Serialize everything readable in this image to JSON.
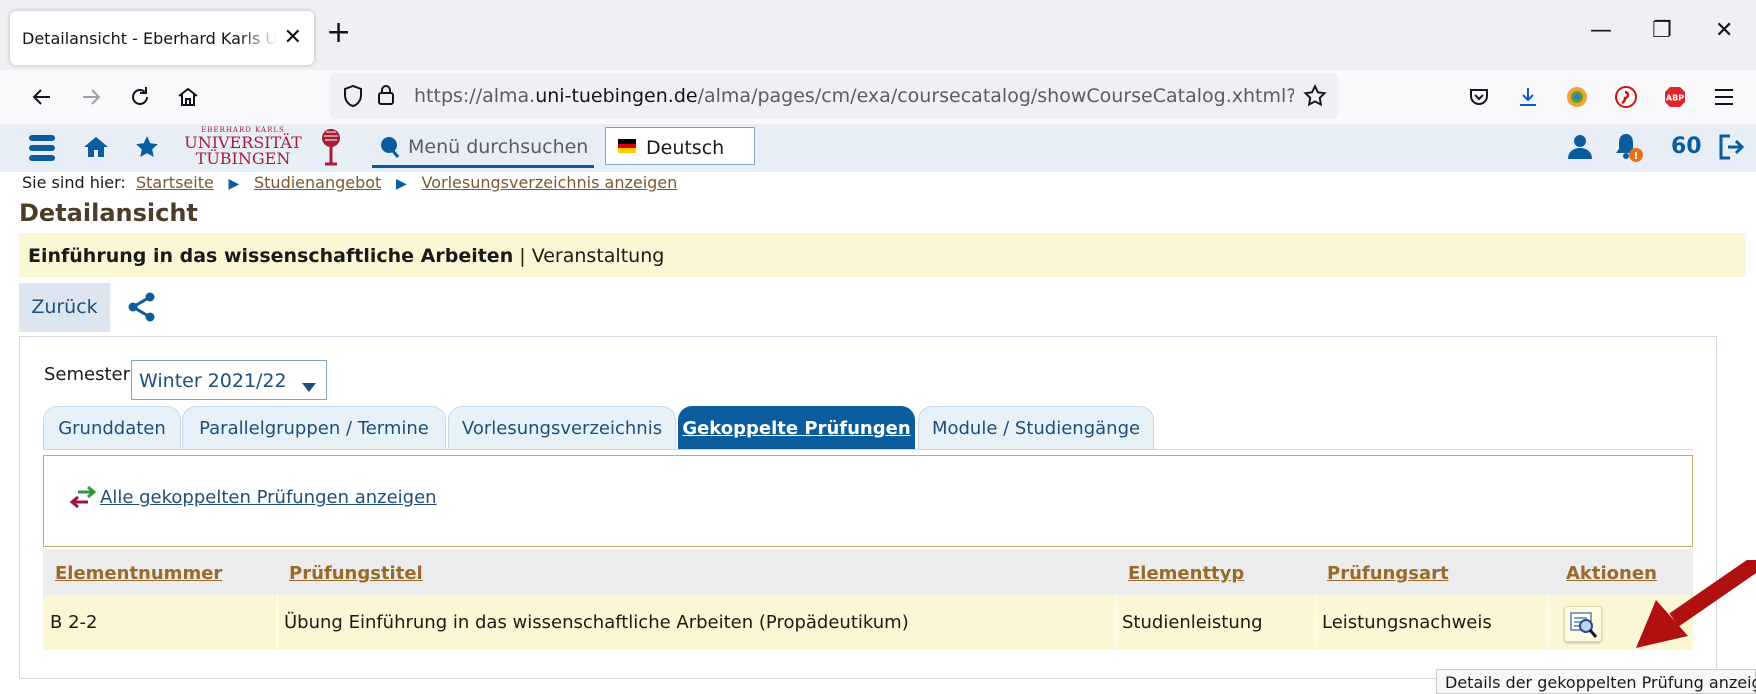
{
  "browser": {
    "tab_title": "Detailansicht - Eberhard Karls Universität Tübingen",
    "url_prefix": "https://alma.",
    "url_domain": "uni-tuebingen.de",
    "url_path": "/alma/pages/cm/exa/coursecatalog/showCourseCatalog.xhtml?_flowId=showCourseCatalog"
  },
  "app": {
    "logo_small": "EBERHARD KARLS",
    "logo_line1": "UNIVERSITÄT",
    "logo_line2": "TÜBINGEN",
    "menu_search_placeholder": "Menü durchsuchen",
    "language": "Deutsch",
    "session_counter": "60"
  },
  "breadcrumb": {
    "label": "Sie sind hier:",
    "items": [
      "Startseite",
      "Studienangebot",
      "Vorlesungsverzeichnis anzeigen"
    ]
  },
  "page": {
    "title": "Detailansicht",
    "course_title": "Einführung in das wissenschaftliche Arbeiten",
    "separator": " | ",
    "course_type": "Veranstaltung",
    "back_label": "Zurück"
  },
  "semester": {
    "label": "Semester",
    "value": "Winter 2021/22"
  },
  "tabs": [
    {
      "label": "Grunddaten"
    },
    {
      "label": "Parallelgruppen / Termine"
    },
    {
      "label": "Vorlesungsverzeichnis"
    },
    {
      "label": "Gekoppelte Prüfungen"
    },
    {
      "label": "Module / Studiengänge"
    }
  ],
  "linked_exams_link": "Alle gekoppelten Prüfungen anzeigen",
  "table": {
    "headers": [
      "Elementnummer",
      "Prüfungstitel",
      "Elementtyp",
      "Prüfungsart",
      "Aktionen"
    ],
    "rows": [
      [
        "B 2-2",
        "Übung Einführung in das wissenschaftliche Arbeiten (Propädeutikum)",
        "Studienleistung",
        "Leistungsnachweis"
      ]
    ]
  },
  "tooltip": "Details der gekoppelten Prüfung anzeigen",
  "colors": {
    "primary": "#0a5c9c",
    "highlight": "#fbf7d4",
    "arrow": "#b01010"
  }
}
